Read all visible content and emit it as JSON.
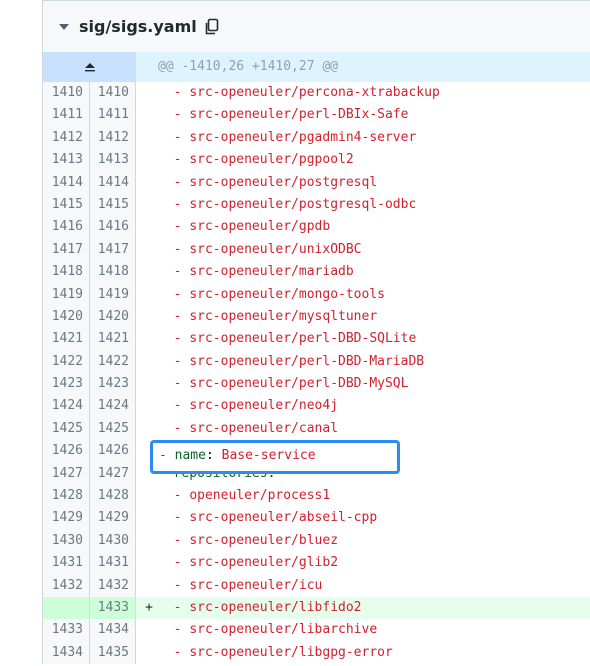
{
  "file": {
    "name": "sig/sigs.yaml",
    "hunk_header": "@@ -1410,26 +1410,27 @@"
  },
  "icons": {
    "collapse": "chevron-down-icon",
    "copy": "copy-icon",
    "expand": "expand-up-icon"
  },
  "colors": {
    "added_bg": "#e6ffec",
    "added_num_bg": "#ccffd8",
    "hunk_bg": "#ddf4ff",
    "highlight": "#2d8cf0"
  },
  "rows": [
    {
      "old": "1410",
      "new": "1410",
      "marker": "",
      "indent": "  ",
      "dash": "- ",
      "value": "src-openeuler/percona-xtrabackup"
    },
    {
      "old": "1411",
      "new": "1411",
      "marker": "",
      "indent": "  ",
      "dash": "- ",
      "value": "src-openeuler/perl-DBIx-Safe"
    },
    {
      "old": "1412",
      "new": "1412",
      "marker": "",
      "indent": "  ",
      "dash": "- ",
      "value": "src-openeuler/pgadmin4-server"
    },
    {
      "old": "1413",
      "new": "1413",
      "marker": "",
      "indent": "  ",
      "dash": "- ",
      "value": "src-openeuler/pgpool2"
    },
    {
      "old": "1414",
      "new": "1414",
      "marker": "",
      "indent": "  ",
      "dash": "- ",
      "value": "src-openeuler/postgresql"
    },
    {
      "old": "1415",
      "new": "1415",
      "marker": "",
      "indent": "  ",
      "dash": "- ",
      "value": "src-openeuler/postgresql-odbc"
    },
    {
      "old": "1416",
      "new": "1416",
      "marker": "",
      "indent": "  ",
      "dash": "- ",
      "value": "src-openeuler/gpdb"
    },
    {
      "old": "1417",
      "new": "1417",
      "marker": "",
      "indent": "  ",
      "dash": "- ",
      "value": "src-openeuler/unixODBC"
    },
    {
      "old": "1418",
      "new": "1418",
      "marker": "",
      "indent": "  ",
      "dash": "- ",
      "value": "src-openeuler/mariadb"
    },
    {
      "old": "1419",
      "new": "1419",
      "marker": "",
      "indent": "  ",
      "dash": "- ",
      "value": "src-openeuler/mongo-tools"
    },
    {
      "old": "1420",
      "new": "1420",
      "marker": "",
      "indent": "  ",
      "dash": "- ",
      "value": "src-openeuler/mysqltuner"
    },
    {
      "old": "1421",
      "new": "1421",
      "marker": "",
      "indent": "  ",
      "dash": "- ",
      "value": "src-openeuler/perl-DBD-SQLite"
    },
    {
      "old": "1422",
      "new": "1422",
      "marker": "",
      "indent": "  ",
      "dash": "- ",
      "value": "src-openeuler/perl-DBD-MariaDB"
    },
    {
      "old": "1423",
      "new": "1423",
      "marker": "",
      "indent": "  ",
      "dash": "- ",
      "value": "src-openeuler/perl-DBD-MySQL"
    },
    {
      "old": "1424",
      "new": "1424",
      "marker": "",
      "indent": "  ",
      "dash": "- ",
      "value": "src-openeuler/neo4j"
    },
    {
      "old": "1425",
      "new": "1425",
      "marker": "",
      "indent": "  ",
      "dash": "- ",
      "value": "src-openeuler/canal"
    },
    {
      "old": "1426",
      "new": "1426",
      "marker": "",
      "indent": "",
      "dash": "- ",
      "key": "name",
      "value": "Base-service"
    },
    {
      "old": "1427",
      "new": "1427",
      "marker": "",
      "indent": "  ",
      "dash": "",
      "key": "repositories",
      "value": ""
    },
    {
      "old": "1428",
      "new": "1428",
      "marker": "",
      "indent": "  ",
      "dash": "- ",
      "value": "openeuler/process1"
    },
    {
      "old": "1429",
      "new": "1429",
      "marker": "",
      "indent": "  ",
      "dash": "- ",
      "value": "src-openeuler/abseil-cpp"
    },
    {
      "old": "1430",
      "new": "1430",
      "marker": "",
      "indent": "  ",
      "dash": "- ",
      "value": "src-openeuler/bluez"
    },
    {
      "old": "1431",
      "new": "1431",
      "marker": "",
      "indent": "  ",
      "dash": "- ",
      "value": "src-openeuler/glib2"
    },
    {
      "old": "1432",
      "new": "1432",
      "marker": "",
      "indent": "  ",
      "dash": "- ",
      "value": "src-openeuler/icu"
    },
    {
      "old": "",
      "new": "1433",
      "marker": "+",
      "indent": "  ",
      "dash": "- ",
      "value": "src-openeuler/libfido2",
      "added": true
    },
    {
      "old": "1433",
      "new": "1434",
      "marker": "",
      "indent": "  ",
      "dash": "- ",
      "value": "src-openeuler/libarchive"
    },
    {
      "old": "1434",
      "new": "1435",
      "marker": "",
      "indent": "  ",
      "dash": "- ",
      "value": "src-openeuler/libgpg-error"
    }
  ],
  "highlight": {
    "dash": "- ",
    "key": "name",
    "value": "Base-service"
  }
}
